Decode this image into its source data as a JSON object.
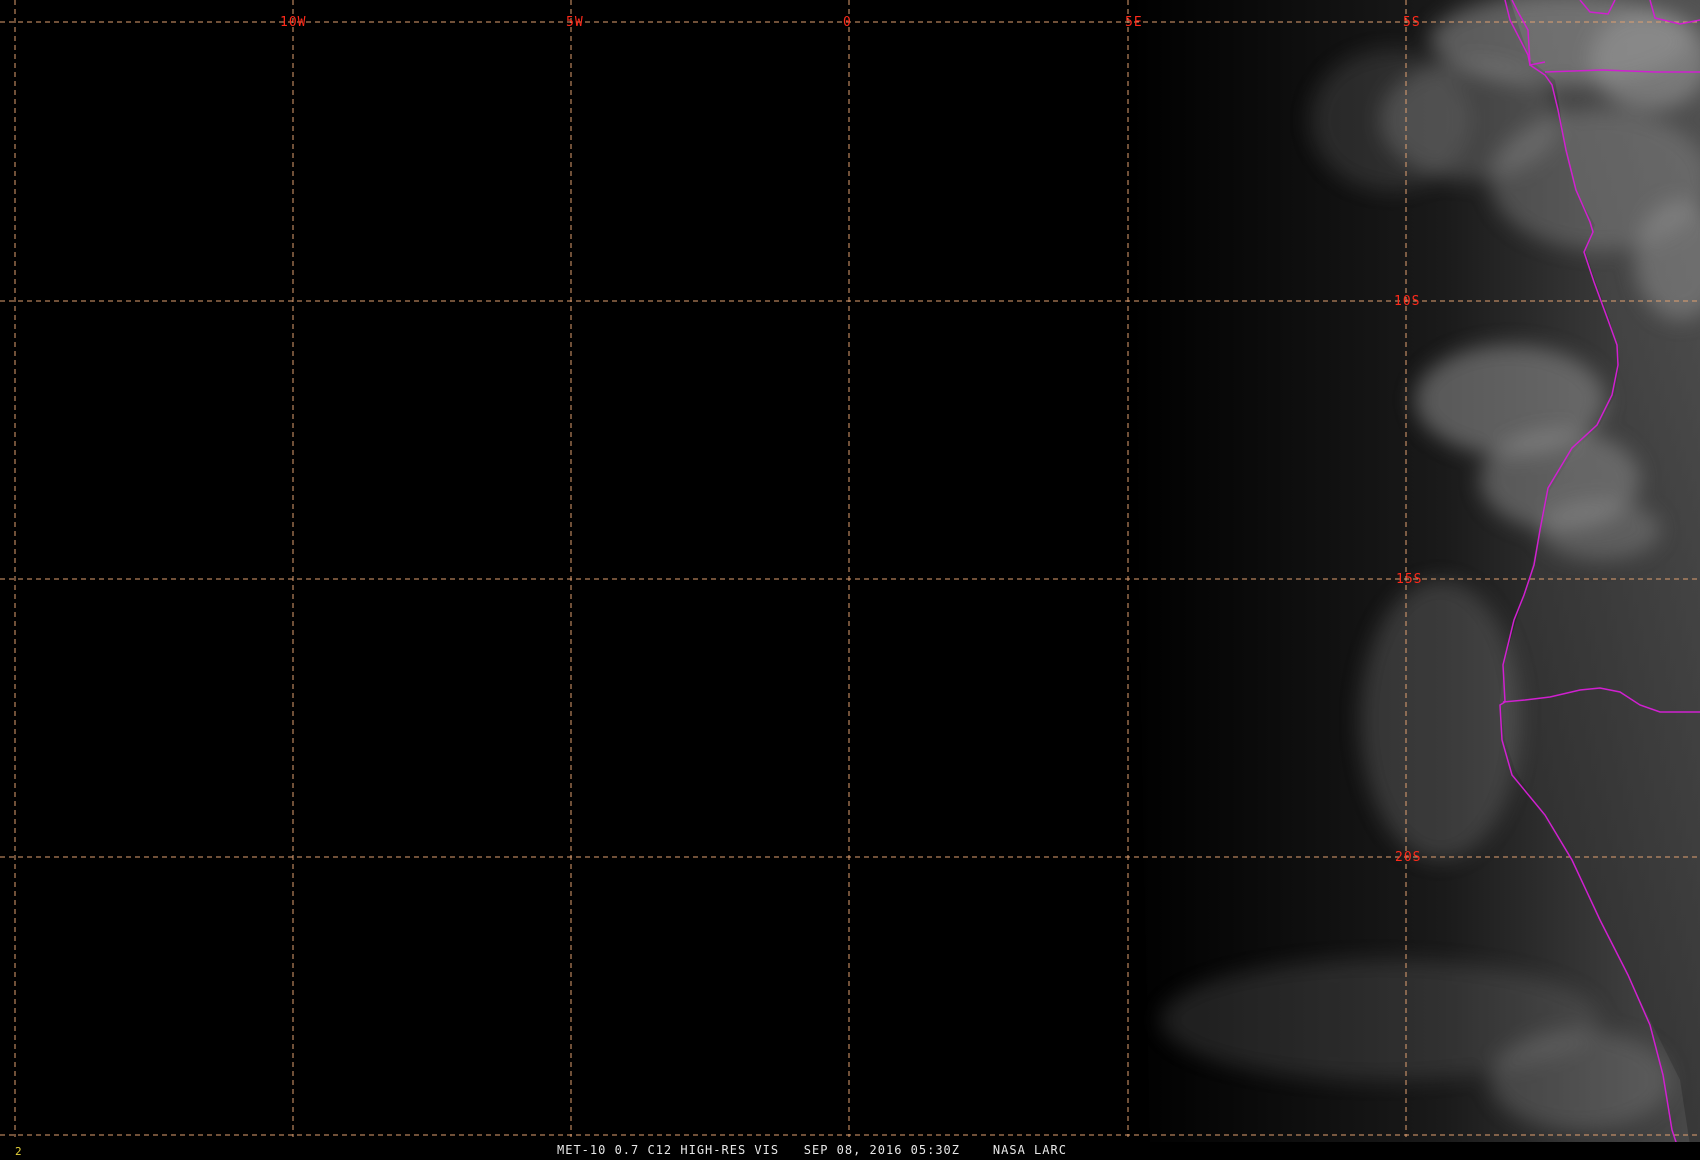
{
  "map": {
    "longitude_labels": [
      "10W",
      "5W",
      "0",
      "5E"
    ],
    "latitude_labels": [
      "5S",
      "10S",
      "15S",
      "20S"
    ],
    "grid_color": "#e0a070",
    "label_color": "#ff2a1a",
    "boundary_color": "#d020d0"
  },
  "status": {
    "frame_number": "2",
    "caption": "MET-10 0.7 C12 HIGH-RES VIS   SEP 08, 2016 05:30Z    NASA LARC"
  }
}
